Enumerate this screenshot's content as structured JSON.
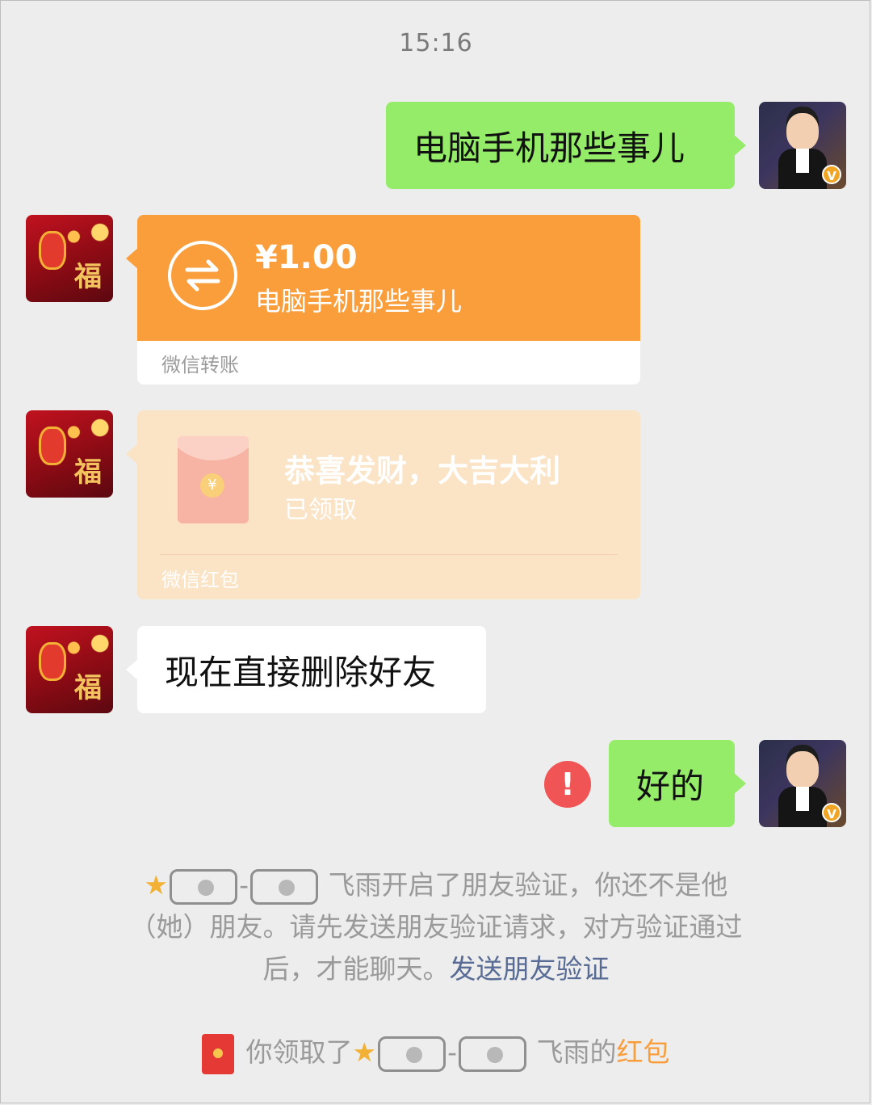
{
  "time": "15:16",
  "messages": {
    "m1": {
      "text": "电脑手机那些事儿"
    },
    "transfer": {
      "amount": "¥1.00",
      "note": "电脑手机那些事儿",
      "footer": "微信转账"
    },
    "redpacket": {
      "title": "恭喜发财，大吉大利",
      "status": "已领取",
      "footer": "微信红包"
    },
    "m3": {
      "text": "现在直接删除好友"
    },
    "m4": {
      "text": "好的",
      "failed_mark": "!"
    }
  },
  "system_notice": {
    "name_suffix": "飞雨",
    "line1_text": "开启了朋友验证，你还不是他",
    "line2": "（她）朋友。请先发送朋友验证请求，对方验证通过",
    "line3_prefix": "后，才能聊天。",
    "link": "发送朋友验证"
  },
  "redpacket_notice": {
    "prefix": "你领取了",
    "name_suffix": "飞雨的",
    "link": "红包"
  },
  "icons": {
    "transfer": "transfer-arrows-icon",
    "star": "star-icon",
    "error": "error-icon"
  },
  "colors": {
    "self_bubble": "#95ec69",
    "transfer": "#fa9d3b",
    "redpacket_opened": "#fbe3c6",
    "link": "#576b95"
  }
}
